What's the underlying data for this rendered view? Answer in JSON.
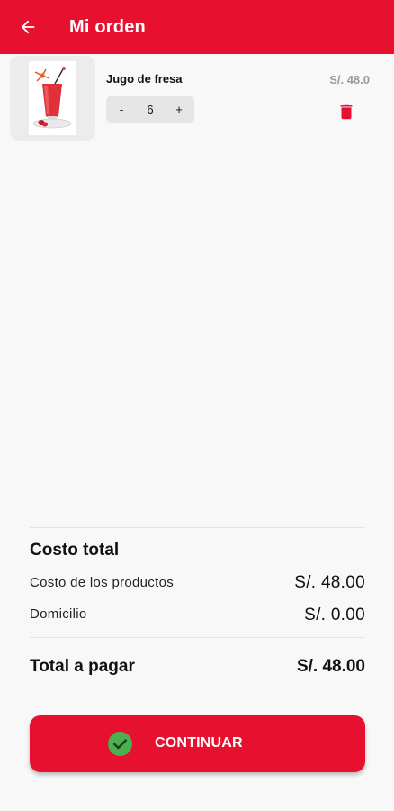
{
  "header": {
    "title": "Mi orden",
    "back_icon": "arrow-left-icon",
    "background_color": "#e8102f"
  },
  "cart": {
    "items": [
      {
        "name": "Jugo de fresa",
        "quantity": "6",
        "decrement_label": "-",
        "increment_label": "+",
        "price": "S/. 48.0",
        "image_icon": "strawberry-juice-image",
        "delete_icon": "trash-icon"
      }
    ]
  },
  "summary": {
    "title": "Costo total",
    "products_label": "Costo de los productos",
    "products_value": "S/. 48.00",
    "delivery_label": "Domicilio",
    "delivery_value": "S/. 0.00",
    "total_label": "Total a pagar",
    "total_value": "S/. 48.00"
  },
  "actions": {
    "continue_label": "CONTINUAR",
    "continue_icon": "check-circle-icon",
    "accent_color": "#e8102f",
    "check_color": "#4caf50"
  }
}
